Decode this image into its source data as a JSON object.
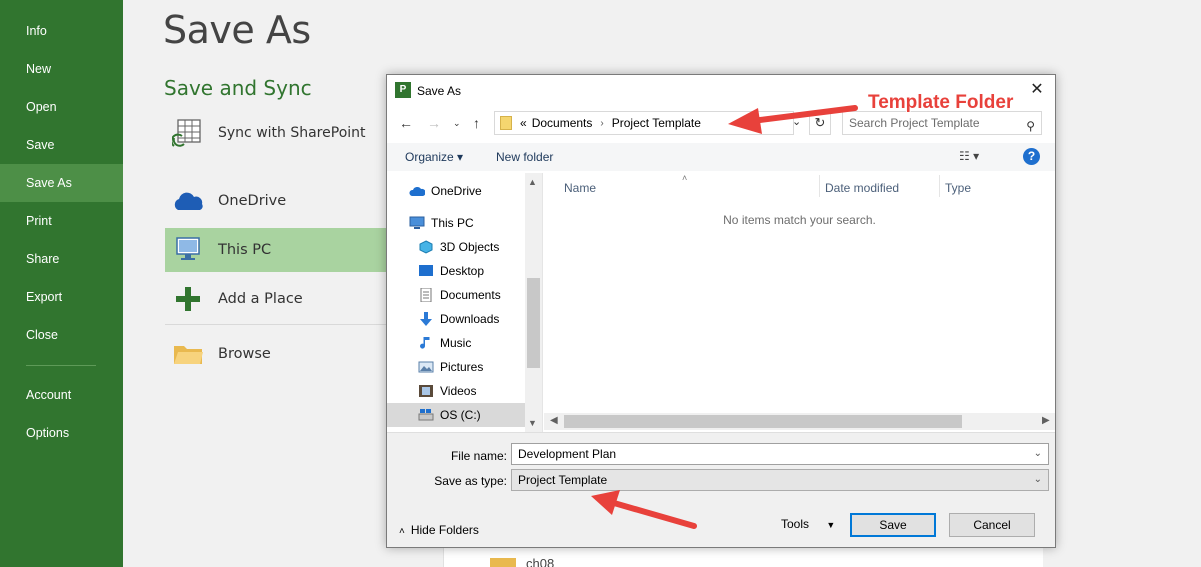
{
  "sidebar": {
    "items": [
      {
        "label": "Info"
      },
      {
        "label": "New"
      },
      {
        "label": "Open"
      },
      {
        "label": "Save"
      },
      {
        "label": "Save As"
      },
      {
        "label": "Print"
      },
      {
        "label": "Share"
      },
      {
        "label": "Export"
      },
      {
        "label": "Close"
      },
      {
        "label": "Account"
      },
      {
        "label": "Options"
      }
    ],
    "active": "Save As",
    "color": "#31752f"
  },
  "backstage": {
    "title": "Save As",
    "section_heading": "Save and Sync",
    "places": [
      {
        "label": "Sync with SharePoint",
        "icon": "sharepoint-sync-icon"
      },
      {
        "label": "OneDrive",
        "icon": "cloud-icon"
      },
      {
        "label": "This PC",
        "icon": "computer-icon"
      },
      {
        "label": "Add a Place",
        "icon": "plus-icon"
      },
      {
        "label": "Browse",
        "icon": "folder-icon"
      }
    ],
    "selected_place": "This PC",
    "background_folder": "ch08"
  },
  "dialog": {
    "title": "Save As",
    "breadcrumb": {
      "overflow": "«",
      "segments": [
        "Documents",
        "Project Template"
      ]
    },
    "search_placeholder": "Search Project Template",
    "commands": {
      "organize": "Organize",
      "new_folder": "New folder"
    },
    "nav_tree": [
      {
        "label": "OneDrive",
        "icon": "cloud-icon"
      },
      {
        "label": "This PC",
        "icon": "computer-icon"
      },
      {
        "label": "3D Objects",
        "icon": "cube-icon"
      },
      {
        "label": "Desktop",
        "icon": "desktop-icon"
      },
      {
        "label": "Documents",
        "icon": "document-icon"
      },
      {
        "label": "Downloads",
        "icon": "download-arrow-icon"
      },
      {
        "label": "Music",
        "icon": "music-note-icon"
      },
      {
        "label": "Pictures",
        "icon": "picture-icon"
      },
      {
        "label": "Videos",
        "icon": "film-icon"
      },
      {
        "label": "OS (C:)",
        "icon": "drive-icon"
      }
    ],
    "selected_tree_item": "OS (C:)",
    "columns": [
      "Name",
      "Date modified",
      "Type"
    ],
    "empty_message": "No items match your search.",
    "file_name_label": "File name:",
    "file_name_value": "Development Plan",
    "save_type_label": "Save as type:",
    "save_type_value": "Project Template",
    "hide_folders_label": "Hide Folders",
    "tools_label": "Tools",
    "save_button": "Save",
    "cancel_button": "Cancel"
  },
  "annotation": {
    "label": "Template Folder",
    "color": "#e8413b"
  }
}
